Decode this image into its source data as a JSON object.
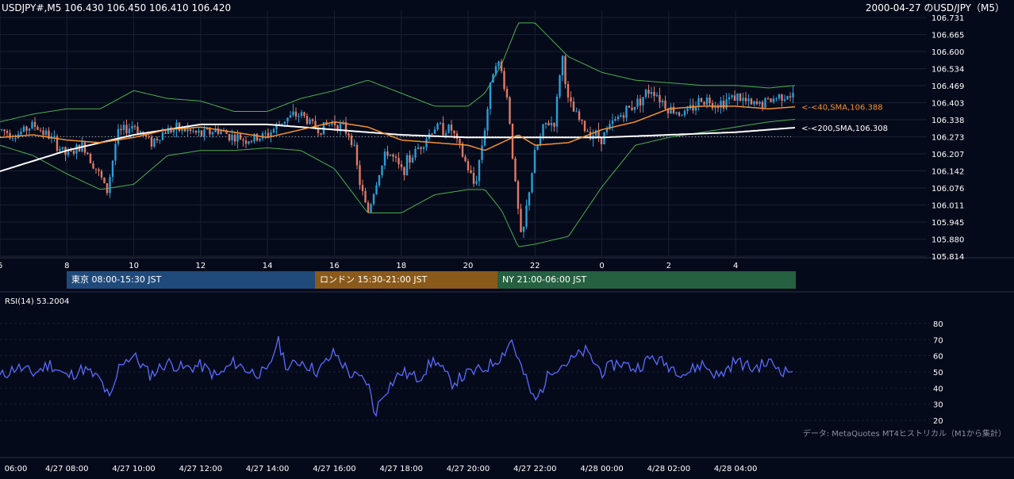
{
  "header": {
    "symbol_quote": "USDJPY#,M5 106.430 106.450 106.410 106.420",
    "title": "2000-04-27 のUSD/JPY（M5）"
  },
  "sessions": [
    {
      "label": "東京 08:00-15:30 JST",
      "color": "#1f4a7a"
    },
    {
      "label": "ロンドン 15:30-21:00 JST",
      "color": "#8a5a1a"
    },
    {
      "label": "NY 21:00-06:00 JST",
      "color": "#256040"
    }
  ],
  "rsi_label": "RSI(14) 53.2004",
  "data_source": "データ: MetaQuotes MT4ヒストリカル（M1から集計）",
  "colors": {
    "background": "#050a1a",
    "up_candle": "#2a9fd8",
    "down_candle": "#e07a66",
    "sma40": "#f5922f",
    "sma200": "#ffffff",
    "bollinger": "#4caf50",
    "rsi": "#5a6bff",
    "grid": "#1a2133"
  },
  "chart_data": [
    {
      "type": "candlestick",
      "x_unit": "hour of day (JST)",
      "xlim": [
        6,
        29.8
      ],
      "ylim": [
        105.814,
        106.731
      ],
      "x_ticks": [
        6,
        8,
        10,
        12,
        14,
        16,
        18,
        20,
        22,
        24,
        26,
        28
      ],
      "x_tick_labels": [
        "6",
        "8",
        "10",
        "12",
        "14",
        "16",
        "18",
        "20",
        "22",
        "0",
        "2",
        "4"
      ],
      "y_ticks": [
        106.731,
        106.665,
        106.6,
        106.534,
        106.469,
        106.403,
        106.338,
        106.273,
        106.207,
        106.142,
        106.076,
        106.011,
        105.945,
        105.88,
        105.814
      ],
      "y_tick_labels": [
        "106.731",
        "106.665",
        "106.600",
        "106.534",
        "106.469",
        "106.403",
        "106.338",
        "106.273",
        "106.207",
        "106.142",
        "106.076",
        "106.011",
        "105.945",
        "105.880",
        "105.814"
      ],
      "grid": true,
      "reference_line": 106.273,
      "annotations": [
        {
          "text": "<-<40,SMA,106.388",
          "series": "SMA40",
          "y": 106.388
        },
        {
          "text": "<-<200,SMA,106.308",
          "series": "SMA200",
          "y": 106.308
        }
      ],
      "sma40": {
        "x": [
          6,
          7,
          8,
          9,
          10,
          11,
          12,
          13,
          14,
          15,
          16,
          17,
          18,
          19,
          20,
          20.5,
          21,
          21.5,
          22,
          23,
          24,
          25,
          26,
          27,
          28,
          29,
          29.8
        ],
        "y": [
          106.27,
          106.28,
          106.26,
          106.25,
          106.27,
          106.3,
          106.31,
          106.29,
          106.27,
          106.3,
          106.33,
          106.31,
          106.26,
          106.25,
          106.24,
          106.22,
          106.25,
          106.28,
          106.24,
          106.25,
          106.3,
          106.33,
          106.38,
          106.39,
          106.39,
          106.38,
          106.388
        ]
      },
      "sma200": {
        "x": [
          6,
          8,
          10,
          12,
          14,
          16,
          18,
          20,
          22,
          24,
          26,
          28,
          29.8
        ],
        "y": [
          106.14,
          106.22,
          106.28,
          106.32,
          106.32,
          106.3,
          106.28,
          106.27,
          106.27,
          106.27,
          106.28,
          106.29,
          106.308
        ]
      },
      "bollinger_upper": {
        "x": [
          6,
          7,
          8,
          9,
          10,
          11,
          12,
          13,
          14,
          15,
          16,
          17,
          18,
          19,
          20,
          20.5,
          21,
          21.5,
          22,
          23,
          24,
          25,
          26,
          27,
          28,
          29,
          29.8
        ],
        "y": [
          106.33,
          106.36,
          106.38,
          106.38,
          106.45,
          106.42,
          106.41,
          106.37,
          106.37,
          106.42,
          106.45,
          106.49,
          106.44,
          106.39,
          106.39,
          106.44,
          106.55,
          106.71,
          106.71,
          106.58,
          106.52,
          106.49,
          106.48,
          106.47,
          106.47,
          106.46,
          106.47
        ]
      },
      "bollinger_lower": {
        "x": [
          6,
          7,
          8,
          9,
          10,
          11,
          12,
          13,
          14,
          15,
          16,
          17,
          18,
          19,
          20,
          20.5,
          21,
          21.5,
          22,
          23,
          24,
          25,
          26,
          27,
          28,
          29,
          29.8
        ],
        "y": [
          106.24,
          106.2,
          106.13,
          106.07,
          106.09,
          106.2,
          106.22,
          106.22,
          106.23,
          106.22,
          106.15,
          105.98,
          105.98,
          106.05,
          106.07,
          106.07,
          105.99,
          105.85,
          105.86,
          105.89,
          106.08,
          106.24,
          106.27,
          106.29,
          106.31,
          106.33,
          106.34
        ]
      },
      "price_path": {
        "x": [
          6,
          6.5,
          7,
          7.5,
          8,
          8.5,
          9,
          9.2,
          9.5,
          10,
          10.5,
          11,
          11.5,
          12,
          12.5,
          13,
          13.5,
          14,
          14.5,
          15,
          15.5,
          16,
          16.5,
          16.8,
          17,
          17.3,
          17.6,
          18,
          18.5,
          19,
          19.5,
          20,
          20.2,
          20.5,
          20.8,
          21,
          21.2,
          21.4,
          21.6,
          21.8,
          22,
          22.3,
          22.6,
          22.8,
          23,
          23.5,
          24,
          24.5,
          25,
          25.5,
          26,
          26.5,
          27,
          27.5,
          28,
          28.5,
          29,
          29.5,
          29.8
        ],
        "y": [
          106.3,
          106.28,
          106.32,
          106.27,
          106.2,
          106.24,
          106.12,
          106.06,
          106.28,
          106.32,
          106.25,
          106.3,
          106.3,
          106.28,
          106.3,
          106.27,
          106.26,
          106.28,
          106.34,
          106.36,
          106.3,
          106.33,
          106.28,
          106.07,
          105.98,
          106.12,
          106.22,
          106.14,
          106.23,
          106.31,
          106.3,
          106.15,
          106.08,
          106.31,
          106.58,
          106.52,
          106.4,
          106.1,
          105.86,
          106.05,
          106.21,
          106.32,
          106.33,
          106.6,
          106.4,
          106.3,
          106.27,
          106.35,
          106.4,
          106.46,
          106.38,
          106.36,
          106.42,
          106.4,
          106.43,
          106.39,
          106.41,
          106.44,
          106.42
        ]
      }
    },
    {
      "type": "line",
      "name": "RSI(14)",
      "ylim": [
        20,
        80
      ],
      "y_ticks": [
        20,
        30,
        40,
        50,
        60,
        70,
        80
      ],
      "y_tick_labels": [
        "20",
        "30",
        "40",
        "50",
        "60",
        "70",
        "80"
      ],
      "grid": true,
      "x_tick_labels": [
        "06:00",
        "4/27 08:00",
        "4/27 10:00",
        "4/27 12:00",
        "4/27 14:00",
        "4/27 16:00",
        "4/27 18:00",
        "4/27 20:00",
        "4/27 22:00",
        "4/28 00:00",
        "4/28 02:00",
        "4/28 04:00"
      ],
      "x": [
        6,
        6.5,
        7,
        7.5,
        8,
        8.5,
        9,
        9.3,
        9.6,
        10,
        10.5,
        11,
        11.5,
        12,
        12.5,
        13,
        13.5,
        14,
        14.3,
        14.6,
        15,
        15.5,
        16,
        16.5,
        17,
        17.2,
        17.5,
        18,
        18.5,
        19,
        19.5,
        20,
        20.5,
        21,
        21.3,
        21.6,
        22,
        22.5,
        23,
        23.5,
        24,
        24.5,
        25,
        25.5,
        26,
        26.5,
        27,
        27.5,
        28,
        28.5,
        29,
        29.5,
        29.8
      ],
      "values": [
        47,
        53,
        49,
        55,
        47,
        52,
        45,
        32,
        56,
        60,
        48,
        56,
        52,
        54,
        47,
        56,
        50,
        49,
        70,
        52,
        57,
        50,
        62,
        48,
        44,
        24,
        38,
        50,
        46,
        58,
        43,
        49,
        52,
        60,
        70,
        52,
        31,
        52,
        56,
        63,
        50,
        56,
        52,
        59,
        54,
        49,
        55,
        47,
        57,
        52,
        56,
        50,
        53.2
      ]
    }
  ]
}
